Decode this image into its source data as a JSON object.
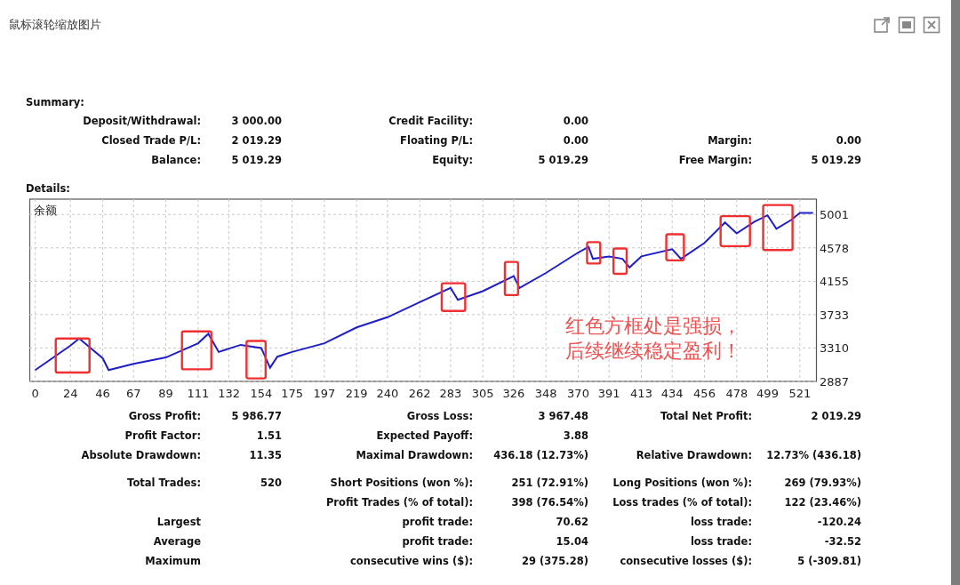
{
  "window": {
    "title": "鼠标滚轮缩放图片"
  },
  "report": {
    "summary_heading": "Summary:",
    "summary_rows": [
      {
        "left": {
          "label": "Deposit/Withdrawal:",
          "value": "3 000.00"
        },
        "middle": {
          "label": "Credit Facility:",
          "value": "0.00"
        }
      },
      {
        "left": {
          "label": "Closed Trade P/L:",
          "value": "2 019.29"
        },
        "middle": {
          "label": "Floating P/L:",
          "value": "0.00"
        },
        "right": {
          "label": "Margin:",
          "value": "0.00"
        }
      },
      {
        "left": {
          "label": "Balance:",
          "value": "5 019.29"
        },
        "middle": {
          "label": "Equity:",
          "value": "5 019.29"
        },
        "right": {
          "label": "Free Margin:",
          "value": "5 019.29"
        }
      }
    ],
    "details_heading": "Details:",
    "chart_data": {
      "type": "line",
      "grid": true,
      "xlim": [
        -4,
        532
      ],
      "ylim": [
        2887,
        5195
      ],
      "xticks": [
        0,
        24,
        46,
        67,
        89,
        111,
        132,
        154,
        175,
        197,
        219,
        240,
        262,
        283,
        305,
        326,
        348,
        370,
        391,
        413,
        434,
        456,
        478,
        499,
        521
      ],
      "yticks": [
        2887,
        3310,
        3733,
        4155,
        4578,
        5001
      ],
      "x": [
        0,
        24,
        30,
        46,
        50,
        67,
        89,
        111,
        118,
        125,
        140,
        154,
        160,
        165,
        175,
        197,
        219,
        240,
        262,
        283,
        288,
        305,
        326,
        330,
        348,
        370,
        377,
        380,
        391,
        400,
        405,
        413,
        434,
        440,
        456,
        470,
        478,
        490,
        499,
        505,
        515,
        521,
        530
      ],
      "series": [
        {
          "name": "余额",
          "color": "#1f1fc8",
          "values": [
            3030,
            3340,
            3430,
            3180,
            3030,
            3110,
            3190,
            3370,
            3490,
            3260,
            3350,
            3310,
            3060,
            3200,
            3260,
            3370,
            3570,
            3700,
            3890,
            4070,
            3920,
            4030,
            4220,
            4070,
            4260,
            4520,
            4590,
            4440,
            4470,
            4440,
            4330,
            4470,
            4560,
            4440,
            4640,
            4900,
            4760,
            4910,
            4990,
            4820,
            4930,
            5020,
            5020
          ]
        }
      ],
      "annotations": [
        "红色方框处是强损，",
        "后续继续稳定盈利！"
      ]
    },
    "detail_groups": [
      [
        {
          "left": {
            "label": "Gross Profit:",
            "value": "5 986.77"
          },
          "middle": {
            "label": "Gross Loss:",
            "value": "3 967.48"
          },
          "right": {
            "label": "Total Net Profit:",
            "value": "2 019.29"
          }
        },
        {
          "left": {
            "label": "Profit Factor:",
            "value": "1.51"
          },
          "middle": {
            "label": "Expected Payoff:",
            "value": "3.88"
          }
        },
        {
          "left": {
            "label": "Absolute Drawdown:",
            "value": "11.35"
          },
          "middle": {
            "label": "Maximal Drawdown:",
            "value": "436.18 (12.73%)"
          },
          "right": {
            "label": "Relative Drawdown:",
            "value": "12.73% (436.18)"
          }
        }
      ],
      [
        {
          "left": {
            "label": "Total Trades:",
            "value": "520"
          },
          "middle": {
            "label": "Short Positions (won %):",
            "value": "251 (72.91%)"
          },
          "right": {
            "label": "Long Positions (won %):",
            "value": "269 (79.93%)"
          }
        },
        {
          "middle": {
            "label": "Profit Trades (% of total):",
            "value": "398 (76.54%)"
          },
          "right": {
            "label": "Loss trades (% of total):",
            "value": "122 (23.46%)"
          }
        },
        {
          "left": {
            "label": "Largest"
          },
          "middle": {
            "label": "profit trade:",
            "value": "70.62"
          },
          "right": {
            "label": "loss trade:",
            "value": "-120.24"
          }
        },
        {
          "left": {
            "label": "Average"
          },
          "middle": {
            "label": "profit trade:",
            "value": "15.04"
          },
          "right": {
            "label": "loss trade:",
            "value": "-32.52"
          }
        },
        {
          "left": {
            "label": "Maximum"
          },
          "middle": {
            "label": "consecutive wins ($):",
            "value": "29 (375.28)"
          },
          "right": {
            "label": "consecutive losses ($):",
            "value": "5 (-309.81)"
          }
        }
      ]
    ]
  }
}
